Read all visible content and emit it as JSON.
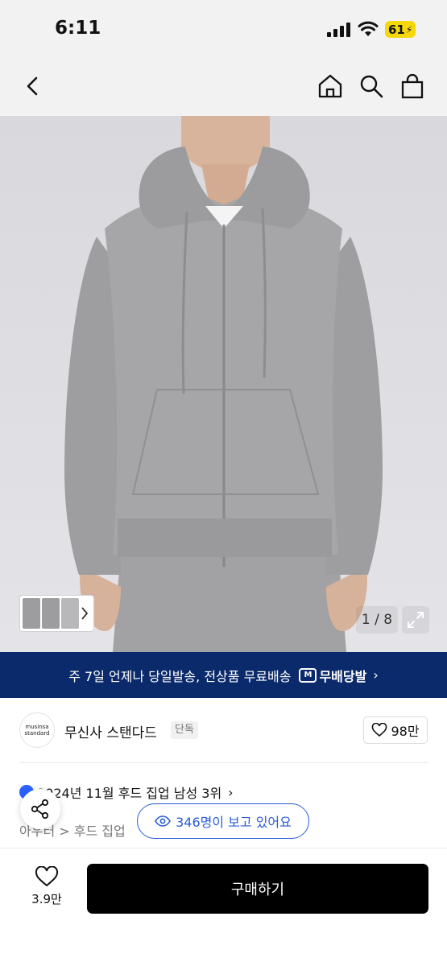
{
  "status_bar": {
    "time": "6:11",
    "battery": "61"
  },
  "nav": {
    "icons": [
      "back-icon",
      "home-icon",
      "search-icon",
      "shopping-bag-icon"
    ]
  },
  "gallery": {
    "counter": "1 / 8"
  },
  "banner": {
    "text": "주 7일 언제나 당일발송, 전상품 무료배송",
    "logo_text": "무배당발",
    "logo_mark": "M"
  },
  "brand": {
    "logo_line1": "musinsa",
    "logo_line2": "standard",
    "name": "무신사 스탠다드",
    "tag": "단독",
    "likes": "98만"
  },
  "ranking": {
    "text": "2024년 11월 후드 집업 남성 3위"
  },
  "breadcrumb": {
    "text": "아우터 > 후드 집업"
  },
  "viewers": {
    "text": "346명이 보고 있어요"
  },
  "bottom_bar": {
    "wish_count": "3.9만",
    "buy_label": "구매하기"
  },
  "colors": {
    "banner_bg": "#0b2a6b",
    "accent_blue": "#2a5bd7",
    "battery": "#f5d80a",
    "buy_bg": "#000000"
  }
}
